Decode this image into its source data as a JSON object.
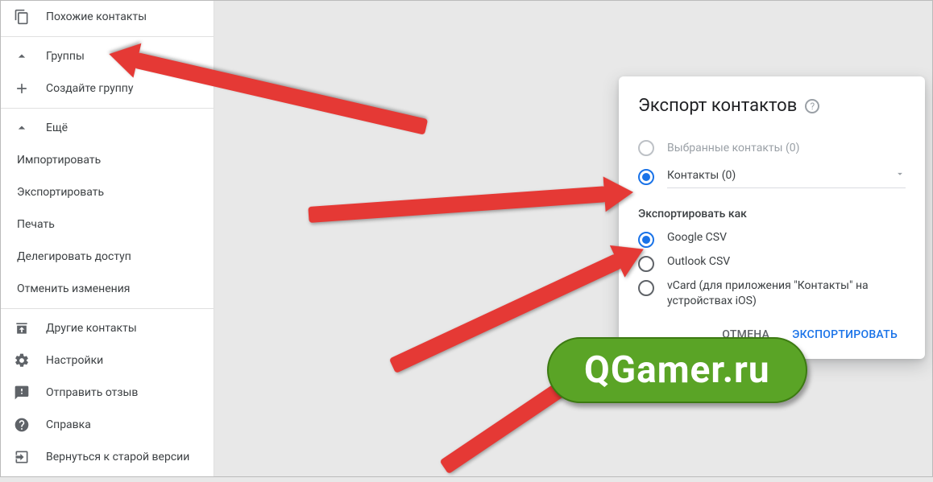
{
  "sidebar": {
    "similar": "Похожие контакты",
    "groups": "Группы",
    "create_group": "Создайте группу",
    "more": "Ещё",
    "import": "Импортировать",
    "export": "Экспортировать",
    "print": "Печать",
    "delegate": "Делегировать доступ",
    "undo_changes": "Отменить изменения",
    "other_contacts": "Другие контакты",
    "settings": "Настройки",
    "feedback": "Отправить отзыв",
    "help": "Справка",
    "old_version": "Вернуться к старой версии"
  },
  "dialog": {
    "title": "Экспорт контактов",
    "selected_contacts": "Выбранные контакты (0)",
    "contacts_option": "Контакты (0)",
    "export_as_label": "Экспортировать как",
    "format_google": "Google CSV",
    "format_outlook": "Outlook CSV",
    "format_vcard": "vCard (для приложения \"Контакты\" на устройствах iOS)",
    "cancel": "ОТМЕНА",
    "export": "ЭКСПОРТИРОВАТЬ"
  },
  "watermark": "QGamer.ru"
}
